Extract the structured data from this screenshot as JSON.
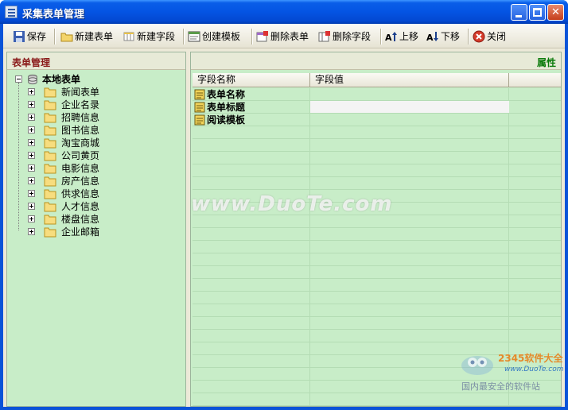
{
  "window": {
    "title": "采集表单管理"
  },
  "toolbar": {
    "items": [
      {
        "label": "保存",
        "icon": "save-icon"
      },
      {
        "label": "新建表单",
        "icon": "new-form-folder-icon"
      },
      {
        "label": "新建字段",
        "icon": "new-field-icon"
      },
      {
        "label": "创建模板",
        "icon": "create-template-icon"
      },
      {
        "label": "删除表单",
        "icon": "delete-form-icon"
      },
      {
        "label": "删除字段",
        "icon": "delete-field-icon"
      },
      {
        "label": "上移",
        "icon": "move-up-icon"
      },
      {
        "label": "下移",
        "icon": "move-down-icon"
      },
      {
        "label": "关闭",
        "icon": "close-circle-icon"
      }
    ]
  },
  "left_panel": {
    "title": "表单管理",
    "root": "本地表单",
    "nodes": [
      "新闻表单",
      "企业名录",
      "招聘信息",
      "图书信息",
      "淘宝商城",
      "公司黄页",
      "电影信息",
      "房产信息",
      "供求信息",
      "人才信息",
      "楼盘信息",
      "企业邮箱"
    ]
  },
  "right_panel": {
    "title": "属性",
    "columns": [
      "字段名称",
      "字段值"
    ],
    "rows": [
      {
        "name": "表单名称",
        "value": ""
      },
      {
        "name": "表单标题",
        "value": ""
      },
      {
        "name": "阅读模板",
        "value": ""
      }
    ]
  },
  "watermark": {
    "text": "www.DuoTe.com",
    "brand": "2345软件大全",
    "url": "www.DuoTe.com",
    "slogan": "国内最安全的软件站"
  }
}
